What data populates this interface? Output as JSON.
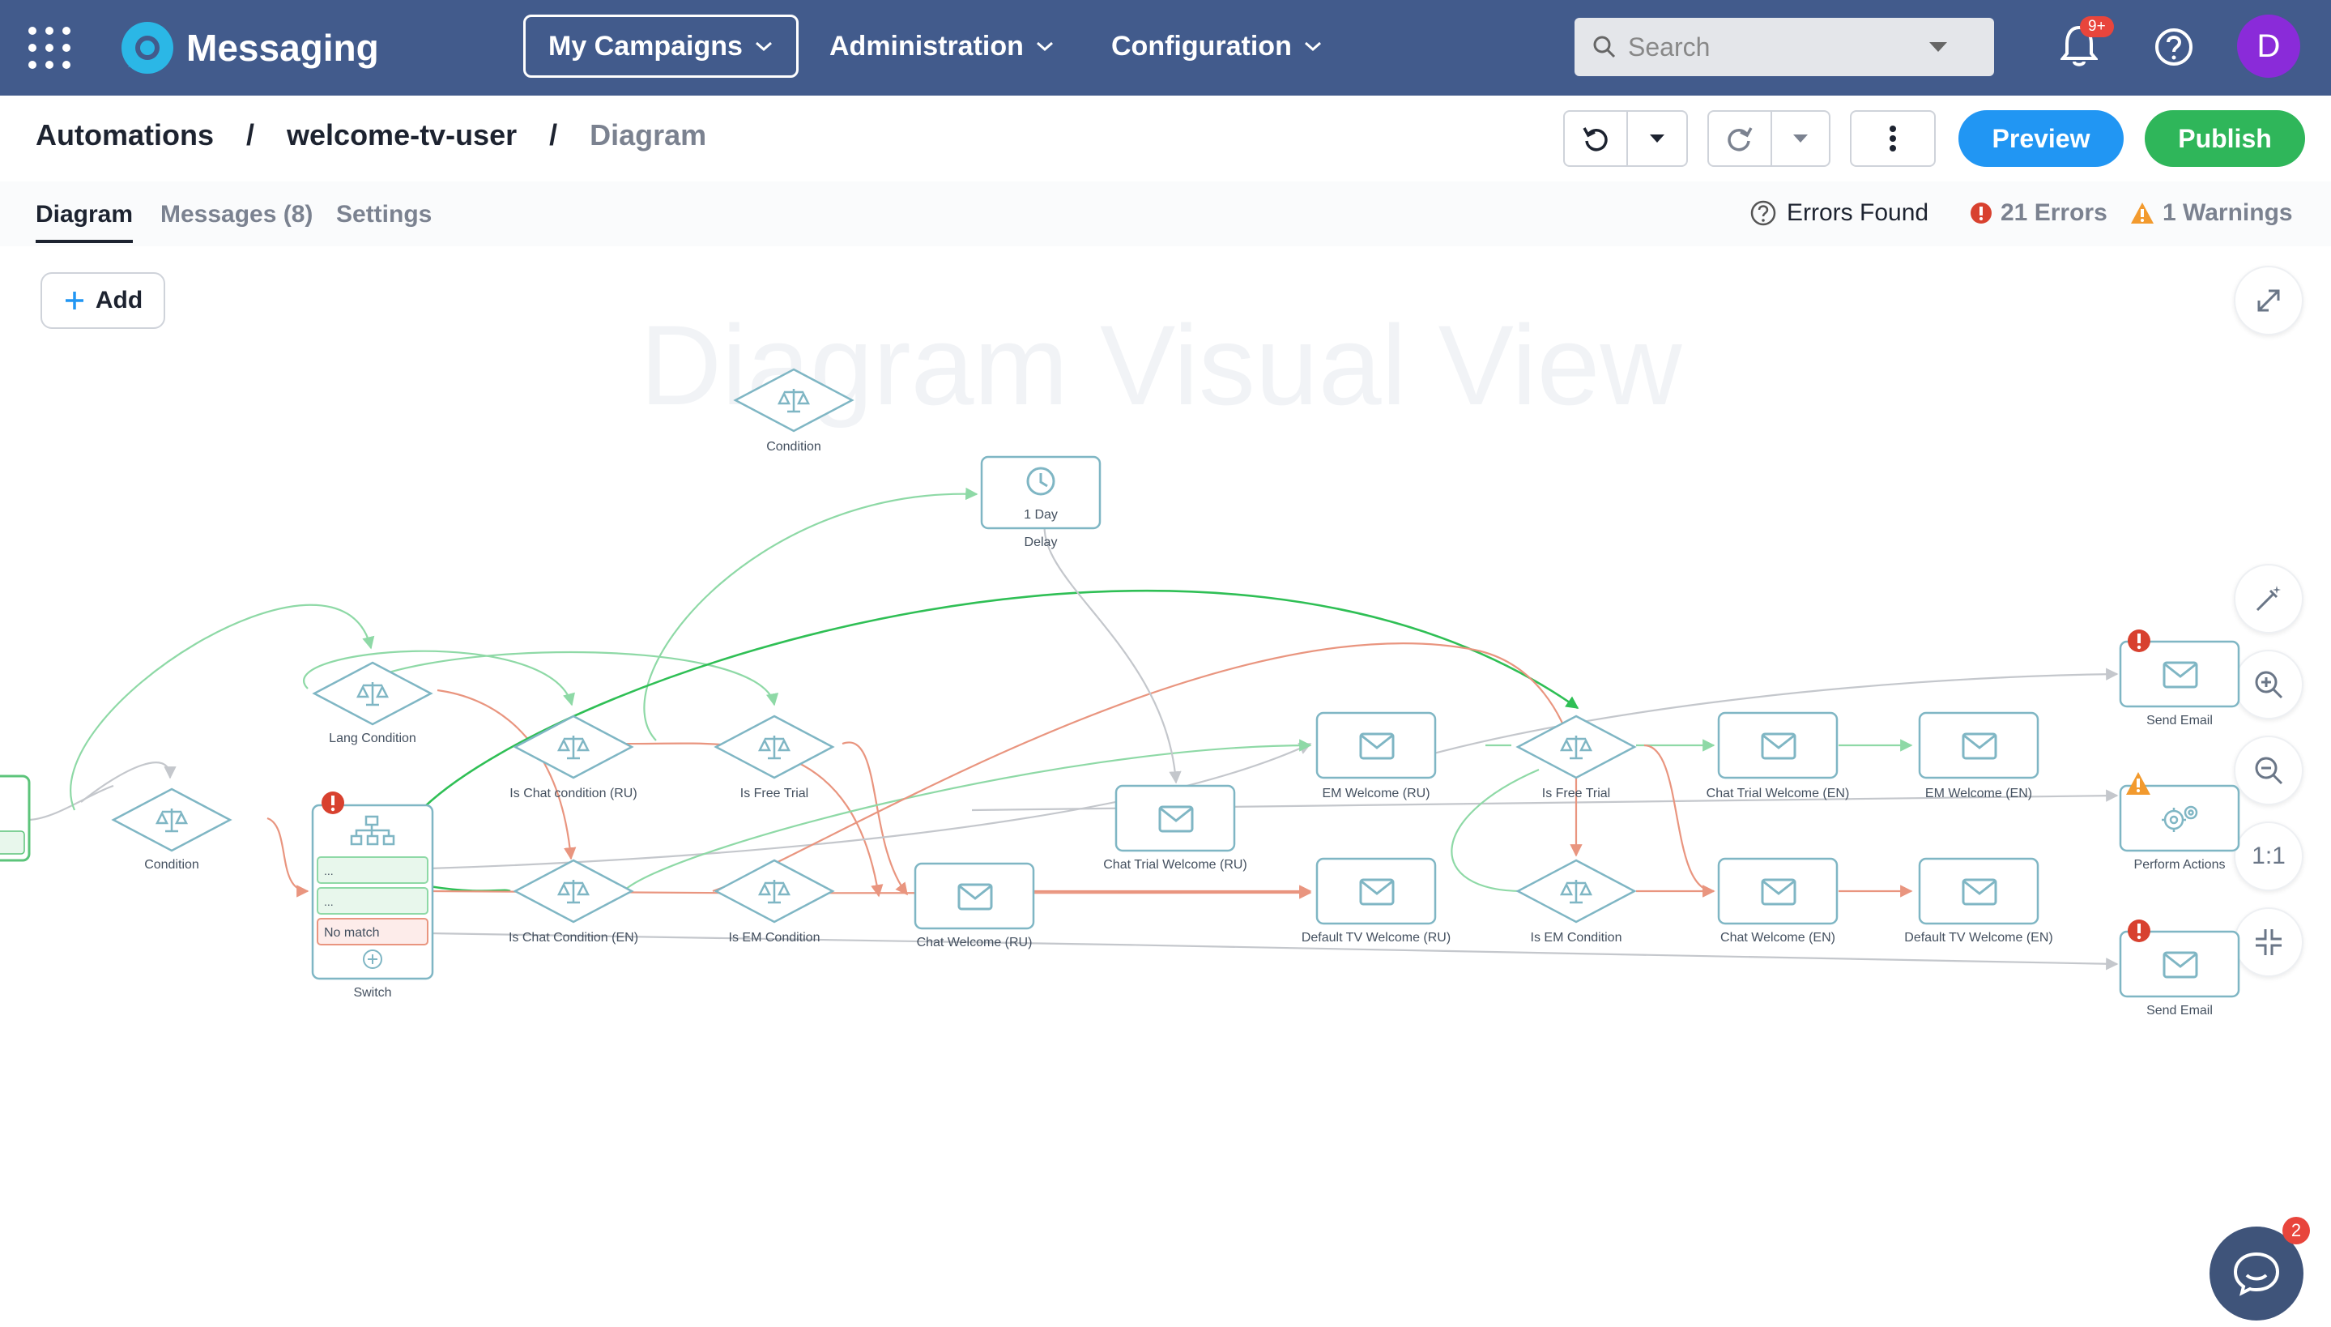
{
  "app": {
    "name": "Messaging",
    "avatar_letter": "D",
    "notifications_badge": "9+",
    "chat_badge": "2"
  },
  "nav": {
    "my_campaigns": "My Campaigns",
    "administration": "Administration",
    "configuration": "Configuration"
  },
  "search": {
    "placeholder": "Search"
  },
  "breadcrumb": {
    "root": "Automations",
    "campaign": "welcome-tv-user",
    "current": "Diagram"
  },
  "actions": {
    "preview": "Preview",
    "publish": "Publish"
  },
  "tabs": {
    "diagram": "Diagram",
    "messages": "Messages (8)",
    "settings": "Settings"
  },
  "status": {
    "errors_found": "Errors Found",
    "errors": "21 Errors",
    "warnings": "1 Warnings"
  },
  "canvas": {
    "add_label": "Add",
    "watermark": "Diagram Visual View",
    "zoom_reset": "1:1",
    "nodes": {
      "condition_top": "Condition",
      "delay_value": "1 Day",
      "delay": "Delay",
      "lang_condition": "Lang Condition",
      "condition_left": "Condition",
      "switch": "Switch",
      "switch_row1": "...",
      "switch_row2": "...",
      "switch_no_match": "No match",
      "is_chat_ru": "Is Chat condition (RU)",
      "is_free_trial_1": "Is Free Trial",
      "is_chat_en": "Is Chat Condition (EN)",
      "is_em_1": "Is EM Condition",
      "chat_welcome_ru": "Chat Welcome (RU)",
      "chat_trial_welcome_ru": "Chat Trial Welcome (RU)",
      "em_welcome_ru": "EM Welcome (RU)",
      "default_tv_welcome_ru": "Default TV Welcome (RU)",
      "is_free_trial_2": "Is Free Trial",
      "is_em_2": "Is EM Condition",
      "chat_trial_welcome_en": "Chat Trial Welcome (EN)",
      "em_welcome_en": "EM Welcome (EN)",
      "chat_welcome_en": "Chat Welcome (EN)",
      "default_tv_welcome_en": "Default TV Welcome (EN)",
      "send_email_1": "Send Email",
      "perform_actions": "Perform Actions",
      "send_email_2": "Send Email"
    }
  },
  "colors": {
    "header": "#425b8c",
    "preview": "#2196f3",
    "publish": "#2fb65a",
    "node_stroke": "#7fb6c4",
    "edge_green": "#8ed9a6",
    "edge_green_dark": "#2fbf55",
    "edge_red": "#e9957f",
    "edge_gray": "#c4c7cc",
    "error": "#d8412f",
    "warning": "#f29a2e"
  }
}
